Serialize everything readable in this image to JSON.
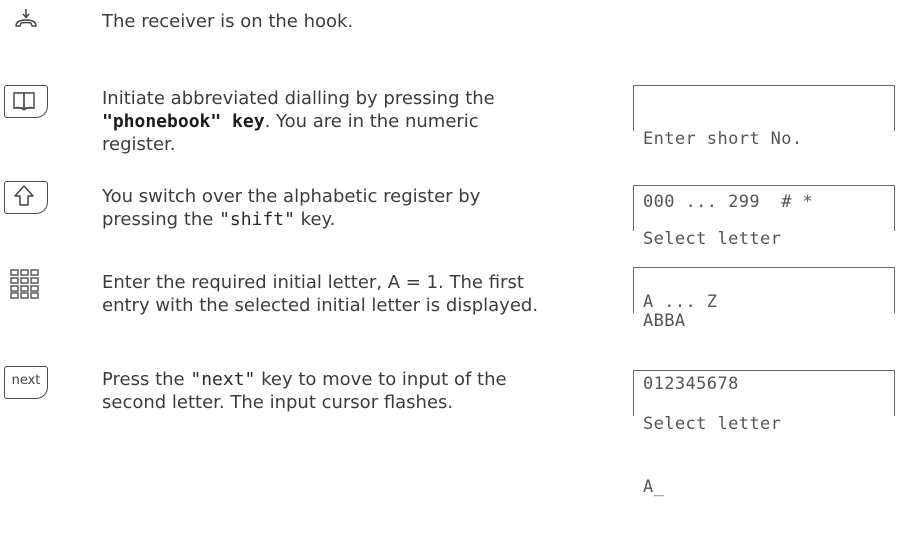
{
  "steps": [
    {
      "icon": "receiver-on-hook-icon",
      "text": "The receiver is on the hook."
    },
    {
      "icon": "phonebook-key-icon",
      "text_a": "Initiate abbreviated dialling by pressing the ",
      "text_key": "\"phonebook\" key",
      "text_b": ". You are in the numeric register.",
      "display": [
        "Enter short No.",
        "000 ... 299  # *"
      ]
    },
    {
      "icon": "shift-key-icon",
      "text_a": "You switch over the alphabetic register by pressing the ",
      "text_key": "\"shift\"",
      "text_b": " key.",
      "display": [
        "Select letter",
        "A ... Z"
      ]
    },
    {
      "icon": "keypad-icon",
      "text": "Enter the required initial letter, A = 1. The first entry with the selected initial letter is displayed.",
      "display": [
        "ABBA",
        "012345678"
      ]
    },
    {
      "icon": "next-key-icon",
      "key_label": "next",
      "text_a": "Press the ",
      "text_key": "\"next\"",
      "text_b": " key to move to input of the second letter. The input cursor flashes.",
      "display": [
        "Select letter",
        "A_"
      ]
    }
  ]
}
